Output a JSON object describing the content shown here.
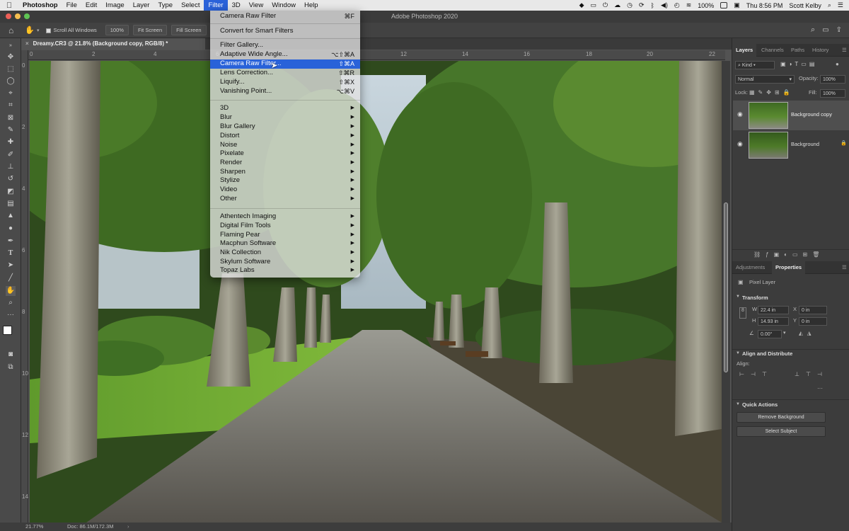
{
  "menubar": {
    "app": "Photoshop",
    "items": [
      "File",
      "Edit",
      "Image",
      "Layer",
      "Type",
      "Select",
      "Filter",
      "3D",
      "View",
      "Window",
      "Help"
    ],
    "active": "Filter",
    "battery": "100%",
    "clock": "Thu 8:56 PM",
    "user": "Scott Kelby"
  },
  "window": {
    "title": "Adobe Photoshop 2020"
  },
  "options": {
    "scroll_all_windows": "Scroll All Windows",
    "zoom_100": "100%",
    "fit_screen": "Fit Screen",
    "fill_screen": "Fill Screen"
  },
  "document": {
    "tab_label": "Dreamy.CR3 @ 21.8% (Background copy, RGB/8) *",
    "zoom": "21.77%",
    "doc_size": "Doc: 86.1M/172.3M",
    "ruler_h": [
      "0",
      "2",
      "4",
      "6",
      "8",
      "10",
      "12",
      "14",
      "16",
      "18",
      "20",
      "22"
    ],
    "ruler_v": [
      "0",
      "2",
      "4",
      "6",
      "8",
      "10",
      "12",
      "14"
    ]
  },
  "filter_menu": {
    "group1": [
      {
        "label": "Camera Raw Filter",
        "shortcut": "⌘F"
      },
      {
        "label": "Convert for Smart Filters",
        "shortcut": ""
      }
    ],
    "group2": [
      {
        "label": "Filter Gallery...",
        "shortcut": ""
      },
      {
        "label": "Adaptive Wide Angle...",
        "shortcut": "⌥⇧⌘A"
      },
      {
        "label": "Camera Raw Filter...",
        "shortcut": "⇧⌘A"
      },
      {
        "label": "Lens Correction...",
        "shortcut": "⇧⌘R"
      },
      {
        "label": "Liquify...",
        "shortcut": "⇧⌘X"
      },
      {
        "label": "Vanishing Point...",
        "shortcut": "⌥⌘V"
      }
    ],
    "group3": [
      "3D",
      "Blur",
      "Blur Gallery",
      "Distort",
      "Noise",
      "Pixelate",
      "Render",
      "Sharpen",
      "Stylize",
      "Video",
      "Other"
    ],
    "group4": [
      "Athentech Imaging",
      "Digital Film Tools",
      "Flaming Pear",
      "Macphun Software",
      "Nik Collection",
      "Skylum Software",
      "Topaz Labs"
    ]
  },
  "layers_panel": {
    "tabs": [
      "Layers",
      "Channels",
      "Paths",
      "History"
    ],
    "kind": "Kind",
    "blend_mode": "Normal",
    "opacity_label": "Opacity:",
    "opacity": "100%",
    "lock_label": "Lock:",
    "fill_label": "Fill:",
    "fill": "100%",
    "layers": [
      {
        "name": "Background copy"
      },
      {
        "name": "Background"
      }
    ]
  },
  "properties_panel": {
    "tabs": [
      "Adjustments",
      "Properties"
    ],
    "layer_type": "Pixel Layer",
    "transform_title": "Transform",
    "w_label": "W",
    "w": "22.4 in",
    "h_label": "H",
    "h": "14.93 in",
    "x_label": "X",
    "x": "0 in",
    "y_label": "Y",
    "y": "0 in",
    "angle": "0.00°",
    "align_title": "Align and Distribute",
    "align_label": "Align:",
    "quick_title": "Quick Actions",
    "remove_bg": "Remove Background",
    "select_subject": "Select Subject"
  },
  "colors": {
    "menu_highlight": "#2962d9",
    "panel_bg": "#3c3c3c",
    "canvas_green": "#3f5e2a"
  }
}
